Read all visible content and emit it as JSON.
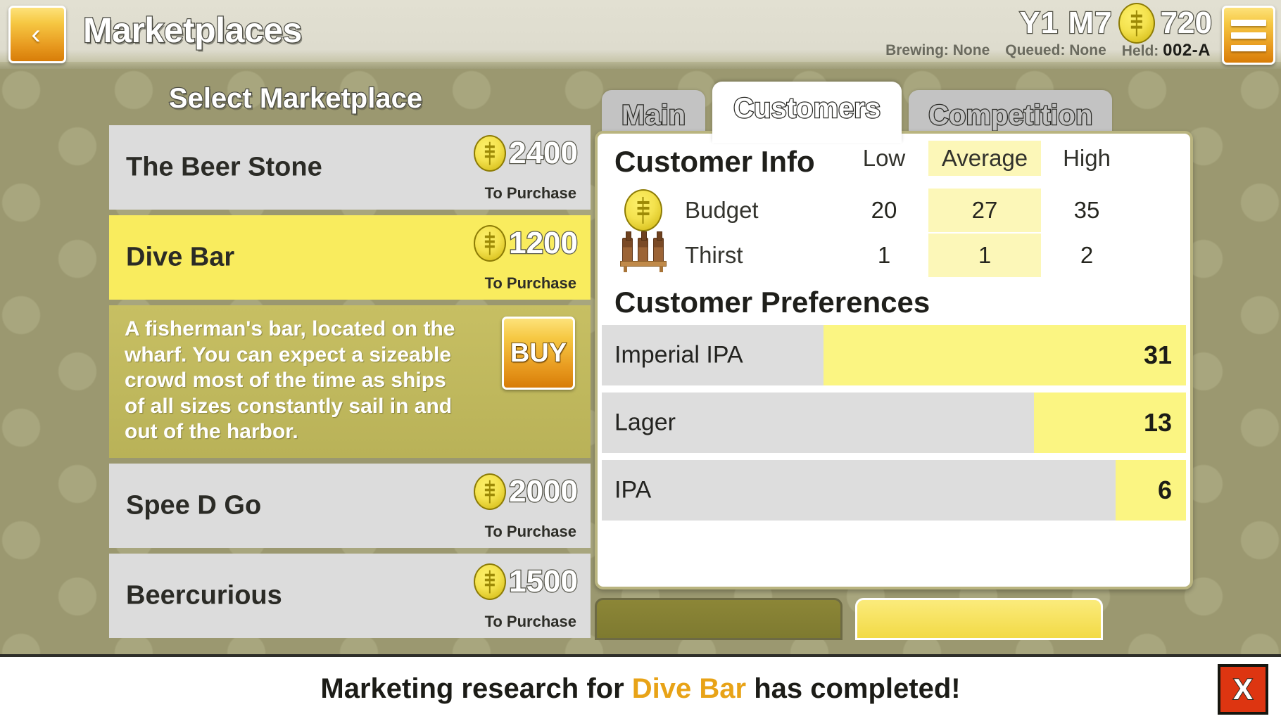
{
  "header": {
    "back_icon": "chevron-left-icon",
    "title": "Marketplaces",
    "date": "Y1 M7",
    "currency_icon": "coin-icon",
    "currency": "720",
    "brewing_label": "Brewing: None",
    "queued_label": "Queued: None",
    "held_label": "Held:",
    "held_value": "002-A",
    "menu_icon": "hamburger-menu-icon"
  },
  "left_panel": {
    "title": "Select Marketplace",
    "to_purchase_label": "To Purchase",
    "items": [
      {
        "name": "The Beer Stone",
        "price": "2400",
        "selected": false
      },
      {
        "name": "Dive Bar",
        "price": "1200",
        "selected": true
      },
      {
        "name": "Spee D Go",
        "price": "2000",
        "selected": false
      },
      {
        "name": "Beercurious",
        "price": "1500",
        "selected": false
      }
    ],
    "selected_description": "A fisherman's bar, located on the wharf.  You can expect a sizeable crowd most of the time as ships of all sizes constantly sail in and out of the harbor.",
    "buy_label": "BUY"
  },
  "right_panel": {
    "tabs": [
      {
        "label": "Main",
        "active": false
      },
      {
        "label": "Customers",
        "active": true
      },
      {
        "label": "Competition",
        "active": false
      }
    ],
    "customer_info": {
      "title": "Customer Info",
      "columns": [
        "Low",
        "Average",
        "High"
      ],
      "rows": [
        {
          "icon": "coin-icon",
          "label": "Budget",
          "low": "20",
          "average": "27",
          "high": "35"
        },
        {
          "icon": "beer-bottles-icon",
          "label": "Thirst",
          "low": "1",
          "average": "1",
          "high": "2"
        }
      ]
    },
    "customer_preferences": {
      "title": "Customer Preferences",
      "items": [
        {
          "name": "Imperial IPA",
          "value": "31"
        },
        {
          "name": "Lager",
          "value": "13"
        },
        {
          "name": "IPA",
          "value": "6"
        }
      ]
    }
  },
  "notification": {
    "prefix": "Marketing research for ",
    "highlight": "Dive Bar",
    "suffix": " has completed!",
    "close_label": "X"
  },
  "chart_data": {
    "type": "bar",
    "title": "Customer Preferences",
    "categories": [
      "Imperial IPA",
      "Lager",
      "IPA"
    ],
    "values": [
      31,
      13,
      6
    ],
    "xlabel": "",
    "ylabel": "",
    "max": 50,
    "orientation": "horizontal-right-aligned",
    "bar_color": "#fbf582",
    "track_color": "#dddddd"
  },
  "colors": {
    "accent_yellow": "#f9ec5e",
    "bar_yellow": "#fbf582",
    "highlight_cell": "#fcf7b8",
    "background_olive": "#9b9870",
    "gold_button": "#f6c843",
    "close_red": "#dd3511",
    "notification_highlight": "#e8a317"
  }
}
